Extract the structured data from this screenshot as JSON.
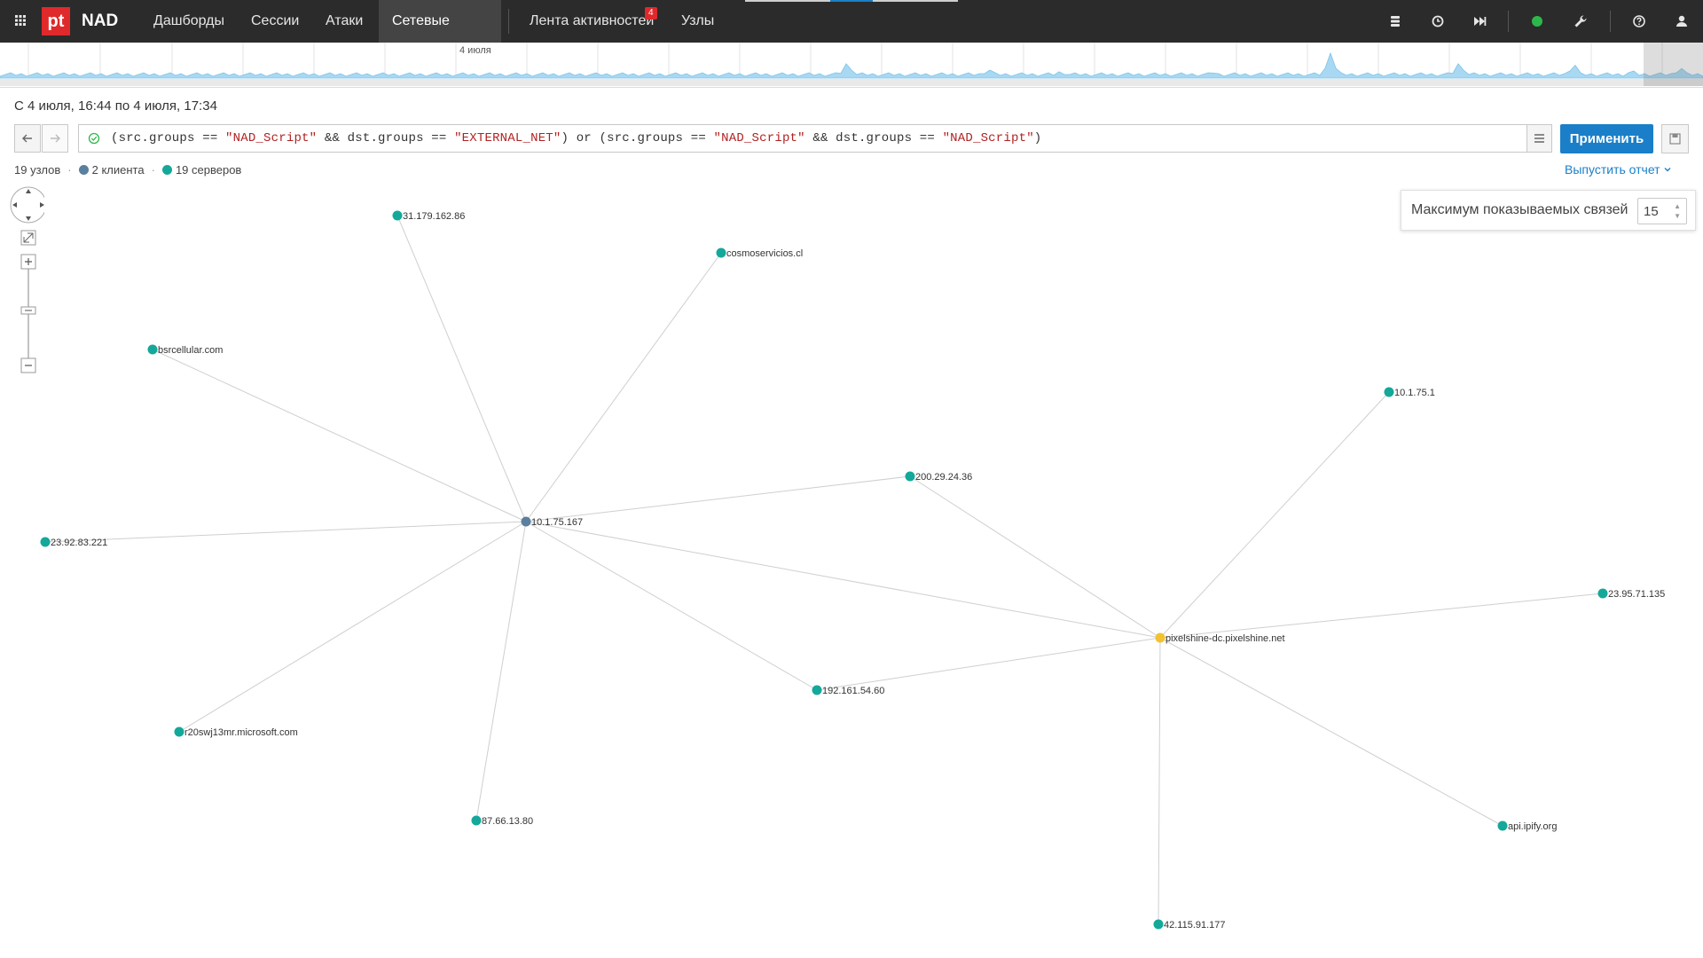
{
  "app": {
    "logo": "pt",
    "name": "NAD"
  },
  "nav": {
    "items": [
      {
        "label": "Дашборды"
      },
      {
        "label": "Сессии"
      },
      {
        "label": "Атаки"
      },
      {
        "label": "Сетевые связи"
      },
      {
        "label": "Лента активностей",
        "badge": "4"
      },
      {
        "label": "Узлы"
      }
    ],
    "active": "Сетевые связи"
  },
  "toolbar_icons": [
    "database-icon",
    "clock-icon",
    "skip-forward-icon",
    "status-ok-indicator",
    "wrench-icon",
    "help-icon",
    "user-icon"
  ],
  "timeline": {
    "date_label": "4 июля"
  },
  "range": {
    "text": "С 4 июля, 16:44 по 4 июля, 17:34"
  },
  "filter": {
    "valid": true,
    "parts": [
      {
        "t": "(src.groups == ",
        "s": false
      },
      {
        "t": "\"NAD_Script\"",
        "s": true
      },
      {
        "t": " && dst.groups == ",
        "s": false
      },
      {
        "t": "\"EXTERNAL_NET\"",
        "s": true
      },
      {
        "t": ") or (src.groups == ",
        "s": false
      },
      {
        "t": "\"NAD_Script\"",
        "s": true
      },
      {
        "t": " && dst.groups == ",
        "s": false
      },
      {
        "t": "\"NAD_Script\"",
        "s": true
      },
      {
        "t": ")",
        "s": false
      }
    ]
  },
  "buttons": {
    "apply": "Применить"
  },
  "summary": {
    "nodes": "19 узлов",
    "clients": "2 клиента",
    "servers": "19 серверов"
  },
  "report": {
    "label": "Выпустить отчет"
  },
  "max_edges": {
    "label": "Максимум показываемых связей",
    "value": "15"
  },
  "colors": {
    "client": "#5b7f9e",
    "server": "#14a89a",
    "highlight": "#f2c230",
    "accent": "#1a7fc8",
    "brand": "#e0292b"
  },
  "graph": {
    "nodes": [
      {
        "id": "n1",
        "label": "31.179.162.86",
        "type": "server"
      },
      {
        "id": "n2",
        "label": "cosmoservicios.cl",
        "type": "server"
      },
      {
        "id": "n3",
        "label": "bsrcellular.com",
        "type": "server"
      },
      {
        "id": "n4",
        "label": "10.1.75.1",
        "type": "server"
      },
      {
        "id": "n5",
        "label": "200.29.24.36",
        "type": "server"
      },
      {
        "id": "n6",
        "label": "10.1.75.167",
        "type": "client"
      },
      {
        "id": "n7",
        "label": "23.92.83.221",
        "type": "server"
      },
      {
        "id": "n8",
        "label": "23.95.71.135",
        "type": "server"
      },
      {
        "id": "n9",
        "label": "pixelshine-dc.pixelshine.net",
        "type": "highlight"
      },
      {
        "id": "n10",
        "label": "192.161.54.60",
        "type": "server"
      },
      {
        "id": "n11",
        "label": "r20swj13mr.microsoft.com",
        "type": "server"
      },
      {
        "id": "n12",
        "label": "87.66.13.80",
        "type": "server"
      },
      {
        "id": "n13",
        "label": "api.ipify.org",
        "type": "server"
      },
      {
        "id": "n14",
        "label": "42.115.91.177",
        "type": "server"
      }
    ],
    "edges": [
      [
        "n6",
        "n1"
      ],
      [
        "n6",
        "n2"
      ],
      [
        "n6",
        "n3"
      ],
      [
        "n6",
        "n5"
      ],
      [
        "n6",
        "n7"
      ],
      [
        "n6",
        "n9"
      ],
      [
        "n6",
        "n10"
      ],
      [
        "n6",
        "n11"
      ],
      [
        "n6",
        "n12"
      ],
      [
        "n9",
        "n4"
      ],
      [
        "n9",
        "n5"
      ],
      [
        "n9",
        "n8"
      ],
      [
        "n9",
        "n10"
      ],
      [
        "n9",
        "n13"
      ],
      [
        "n9",
        "n14"
      ]
    ]
  }
}
